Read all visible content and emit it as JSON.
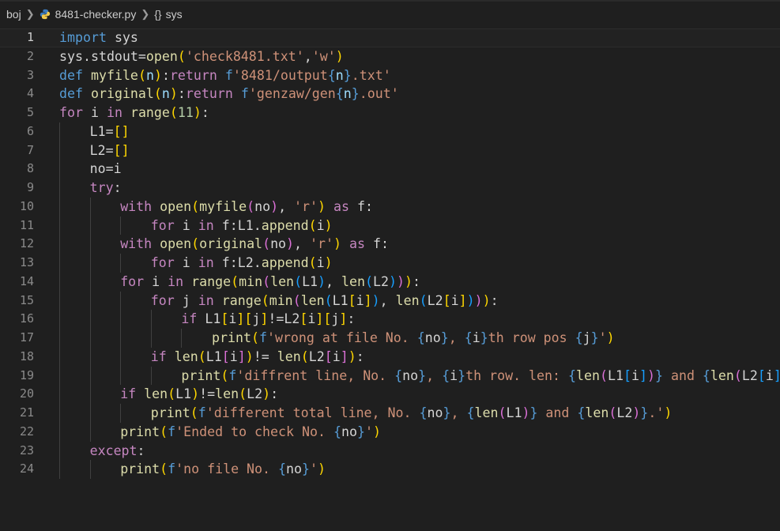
{
  "breadcrumb": {
    "folder": "boj",
    "file": "8481-checker.py",
    "symbol": "sys"
  },
  "editor": {
    "lines": [
      {
        "num": "1",
        "indent": 0,
        "tokens": [
          [
            "k",
            "import"
          ],
          [
            "w",
            " sys"
          ]
        ]
      },
      {
        "num": "2",
        "indent": 0,
        "tokens": [
          [
            "w",
            "sys.stdout="
          ],
          [
            "f",
            "open"
          ],
          [
            "b1",
            "("
          ],
          [
            "s",
            "'check8481.txt'"
          ],
          [
            "w",
            ","
          ],
          [
            "s",
            "'w'"
          ],
          [
            "b1",
            ")"
          ]
        ]
      },
      {
        "num": "3",
        "indent": 0,
        "tokens": [
          [
            "k",
            "def"
          ],
          [
            "w",
            " "
          ],
          [
            "f",
            "myfile"
          ],
          [
            "b1",
            "("
          ],
          [
            "v",
            "n"
          ],
          [
            "b1",
            ")"
          ],
          [
            "w",
            ":"
          ],
          [
            "c",
            "return"
          ],
          [
            "w",
            " "
          ],
          [
            "k",
            "f"
          ],
          [
            "s",
            "'8481/output"
          ],
          [
            "k",
            "{"
          ],
          [
            "v",
            "n"
          ],
          [
            "k",
            "}"
          ],
          [
            "s",
            ".txt'"
          ]
        ]
      },
      {
        "num": "4",
        "indent": 0,
        "tokens": [
          [
            "k",
            "def"
          ],
          [
            "w",
            " "
          ],
          [
            "f",
            "original"
          ],
          [
            "b1",
            "("
          ],
          [
            "v",
            "n"
          ],
          [
            "b1",
            ")"
          ],
          [
            "w",
            ":"
          ],
          [
            "c",
            "return"
          ],
          [
            "w",
            " "
          ],
          [
            "k",
            "f"
          ],
          [
            "s",
            "'genzaw/gen"
          ],
          [
            "k",
            "{"
          ],
          [
            "v",
            "n"
          ],
          [
            "k",
            "}"
          ],
          [
            "s",
            ".out'"
          ]
        ]
      },
      {
        "num": "5",
        "indent": 0,
        "tokens": [
          [
            "c",
            "for"
          ],
          [
            "w",
            " i "
          ],
          [
            "c",
            "in"
          ],
          [
            "w",
            " "
          ],
          [
            "f",
            "range"
          ],
          [
            "b1",
            "("
          ],
          [
            "n",
            "11"
          ],
          [
            "b1",
            ")"
          ],
          [
            "w",
            ":"
          ]
        ]
      },
      {
        "num": "6",
        "indent": 1,
        "tokens": [
          [
            "w",
            "L1="
          ],
          [
            "b1",
            "[]"
          ]
        ]
      },
      {
        "num": "7",
        "indent": 1,
        "tokens": [
          [
            "w",
            "L2="
          ],
          [
            "b1",
            "[]"
          ]
        ]
      },
      {
        "num": "8",
        "indent": 1,
        "tokens": [
          [
            "w",
            "no=i"
          ]
        ]
      },
      {
        "num": "9",
        "indent": 1,
        "tokens": [
          [
            "c",
            "try"
          ],
          [
            "w",
            ":"
          ]
        ]
      },
      {
        "num": "10",
        "indent": 2,
        "tokens": [
          [
            "c",
            "with"
          ],
          [
            "w",
            " "
          ],
          [
            "f",
            "open"
          ],
          [
            "b1",
            "("
          ],
          [
            "f",
            "myfile"
          ],
          [
            "b2",
            "("
          ],
          [
            "w",
            "no"
          ],
          [
            "b2",
            ")"
          ],
          [
            "w",
            ", "
          ],
          [
            "s",
            "'r'"
          ],
          [
            "b1",
            ")"
          ],
          [
            "w",
            " "
          ],
          [
            "c",
            "as"
          ],
          [
            "w",
            " f:"
          ]
        ]
      },
      {
        "num": "11",
        "indent": 3,
        "tokens": [
          [
            "c",
            "for"
          ],
          [
            "w",
            " i "
          ],
          [
            "c",
            "in"
          ],
          [
            "w",
            " f:L1."
          ],
          [
            "f",
            "append"
          ],
          [
            "b1",
            "("
          ],
          [
            "w",
            "i"
          ],
          [
            "b1",
            ")"
          ]
        ]
      },
      {
        "num": "12",
        "indent": 2,
        "tokens": [
          [
            "c",
            "with"
          ],
          [
            "w",
            " "
          ],
          [
            "f",
            "open"
          ],
          [
            "b1",
            "("
          ],
          [
            "f",
            "original"
          ],
          [
            "b2",
            "("
          ],
          [
            "w",
            "no"
          ],
          [
            "b2",
            ")"
          ],
          [
            "w",
            ", "
          ],
          [
            "s",
            "'r'"
          ],
          [
            "b1",
            ")"
          ],
          [
            "w",
            " "
          ],
          [
            "c",
            "as"
          ],
          [
            "w",
            " f:"
          ]
        ]
      },
      {
        "num": "13",
        "indent": 3,
        "tokens": [
          [
            "c",
            "for"
          ],
          [
            "w",
            " i "
          ],
          [
            "c",
            "in"
          ],
          [
            "w",
            " f:L2."
          ],
          [
            "f",
            "append"
          ],
          [
            "b1",
            "("
          ],
          [
            "w",
            "i"
          ],
          [
            "b1",
            ")"
          ]
        ]
      },
      {
        "num": "14",
        "indent": 2,
        "tokens": [
          [
            "c",
            "for"
          ],
          [
            "w",
            " i "
          ],
          [
            "c",
            "in"
          ],
          [
            "w",
            " "
          ],
          [
            "f",
            "range"
          ],
          [
            "b1",
            "("
          ],
          [
            "f",
            "min"
          ],
          [
            "b2",
            "("
          ],
          [
            "f",
            "len"
          ],
          [
            "b3",
            "("
          ],
          [
            "w",
            "L1"
          ],
          [
            "b3",
            ")"
          ],
          [
            "w",
            ", "
          ],
          [
            "f",
            "len"
          ],
          [
            "b3",
            "("
          ],
          [
            "w",
            "L2"
          ],
          [
            "b3",
            ")"
          ],
          [
            "b2",
            ")"
          ],
          [
            "b1",
            ")"
          ],
          [
            "w",
            ":"
          ]
        ]
      },
      {
        "num": "15",
        "indent": 3,
        "tokens": [
          [
            "c",
            "for"
          ],
          [
            "w",
            " j "
          ],
          [
            "c",
            "in"
          ],
          [
            "w",
            " "
          ],
          [
            "f",
            "range"
          ],
          [
            "b1",
            "("
          ],
          [
            "f",
            "min"
          ],
          [
            "b2",
            "("
          ],
          [
            "f",
            "len"
          ],
          [
            "b3",
            "("
          ],
          [
            "w",
            "L1"
          ],
          [
            "b1",
            "["
          ],
          [
            "w",
            "i"
          ],
          [
            "b1",
            "]"
          ],
          [
            "b3",
            ")"
          ],
          [
            "w",
            ", "
          ],
          [
            "f",
            "len"
          ],
          [
            "b3",
            "("
          ],
          [
            "w",
            "L2"
          ],
          [
            "b1",
            "["
          ],
          [
            "w",
            "i"
          ],
          [
            "b1",
            "]"
          ],
          [
            "b3",
            ")"
          ],
          [
            "b2",
            ")"
          ],
          [
            "b1",
            ")"
          ],
          [
            "w",
            ":"
          ]
        ]
      },
      {
        "num": "16",
        "indent": 4,
        "tokens": [
          [
            "c",
            "if"
          ],
          [
            "w",
            " L1"
          ],
          [
            "b1",
            "["
          ],
          [
            "w",
            "i"
          ],
          [
            "b1",
            "]"
          ],
          [
            "b1",
            "["
          ],
          [
            "w",
            "j"
          ],
          [
            "b1",
            "]"
          ],
          [
            "w",
            "!=L2"
          ],
          [
            "b1",
            "["
          ],
          [
            "w",
            "i"
          ],
          [
            "b1",
            "]"
          ],
          [
            "b1",
            "["
          ],
          [
            "w",
            "j"
          ],
          [
            "b1",
            "]"
          ],
          [
            "w",
            ":"
          ]
        ]
      },
      {
        "num": "17",
        "indent": 5,
        "tokens": [
          [
            "f",
            "print"
          ],
          [
            "b1",
            "("
          ],
          [
            "k",
            "f"
          ],
          [
            "s",
            "'wrong at file No. "
          ],
          [
            "k",
            "{"
          ],
          [
            "w",
            "no"
          ],
          [
            "k",
            "}"
          ],
          [
            "s",
            ", "
          ],
          [
            "k",
            "{"
          ],
          [
            "w",
            "i"
          ],
          [
            "k",
            "}"
          ],
          [
            "s",
            "th row pos "
          ],
          [
            "k",
            "{"
          ],
          [
            "w",
            "j"
          ],
          [
            "k",
            "}"
          ],
          [
            "s",
            "'"
          ],
          [
            "b1",
            ")"
          ]
        ]
      },
      {
        "num": "18",
        "indent": 3,
        "tokens": [
          [
            "c",
            "if"
          ],
          [
            "w",
            " "
          ],
          [
            "f",
            "len"
          ],
          [
            "b1",
            "("
          ],
          [
            "w",
            "L1"
          ],
          [
            "b2",
            "["
          ],
          [
            "w",
            "i"
          ],
          [
            "b2",
            "]"
          ],
          [
            "b1",
            ")"
          ],
          [
            "w",
            "!= "
          ],
          [
            "f",
            "len"
          ],
          [
            "b1",
            "("
          ],
          [
            "w",
            "L2"
          ],
          [
            "b2",
            "["
          ],
          [
            "w",
            "i"
          ],
          [
            "b2",
            "]"
          ],
          [
            "b1",
            ")"
          ],
          [
            "w",
            ":"
          ]
        ]
      },
      {
        "num": "19",
        "indent": 4,
        "tokens": [
          [
            "f",
            "print"
          ],
          [
            "b1",
            "("
          ],
          [
            "k",
            "f"
          ],
          [
            "s",
            "'diffrent line, No. "
          ],
          [
            "k",
            "{"
          ],
          [
            "w",
            "no"
          ],
          [
            "k",
            "}"
          ],
          [
            "s",
            ", "
          ],
          [
            "k",
            "{"
          ],
          [
            "w",
            "i"
          ],
          [
            "k",
            "}"
          ],
          [
            "s",
            "th row. len: "
          ],
          [
            "k",
            "{"
          ],
          [
            "f",
            "len"
          ],
          [
            "b2",
            "("
          ],
          [
            "w",
            "L1"
          ],
          [
            "b3",
            "["
          ],
          [
            "w",
            "i"
          ],
          [
            "b3",
            "]"
          ],
          [
            "b2",
            ")"
          ],
          [
            "k",
            "}"
          ],
          [
            "s",
            " and "
          ],
          [
            "k",
            "{"
          ],
          [
            "f",
            "len"
          ],
          [
            "b2",
            "("
          ],
          [
            "w",
            "L2"
          ],
          [
            "b3",
            "["
          ],
          [
            "w",
            "i"
          ],
          [
            "b3",
            "]"
          ],
          [
            "b2",
            ")"
          ],
          [
            "k",
            "}"
          ],
          [
            "s",
            "'"
          ]
        ]
      },
      {
        "num": "20",
        "indent": 2,
        "tokens": [
          [
            "c",
            "if"
          ],
          [
            "w",
            " "
          ],
          [
            "f",
            "len"
          ],
          [
            "b1",
            "("
          ],
          [
            "w",
            "L1"
          ],
          [
            "b1",
            ")"
          ],
          [
            "w",
            "!="
          ],
          [
            "f",
            "len"
          ],
          [
            "b1",
            "("
          ],
          [
            "w",
            "L2"
          ],
          [
            "b1",
            ")"
          ],
          [
            "w",
            ":"
          ]
        ]
      },
      {
        "num": "21",
        "indent": 3,
        "tokens": [
          [
            "f",
            "print"
          ],
          [
            "b1",
            "("
          ],
          [
            "k",
            "f"
          ],
          [
            "s",
            "'different total line, No. "
          ],
          [
            "k",
            "{"
          ],
          [
            "w",
            "no"
          ],
          [
            "k",
            "}"
          ],
          [
            "s",
            ", "
          ],
          [
            "k",
            "{"
          ],
          [
            "f",
            "len"
          ],
          [
            "b2",
            "("
          ],
          [
            "w",
            "L1"
          ],
          [
            "b2",
            ")"
          ],
          [
            "k",
            "}"
          ],
          [
            "s",
            " and "
          ],
          [
            "k",
            "{"
          ],
          [
            "f",
            "len"
          ],
          [
            "b2",
            "("
          ],
          [
            "w",
            "L2"
          ],
          [
            "b2",
            ")"
          ],
          [
            "k",
            "}"
          ],
          [
            "s",
            ".'"
          ],
          [
            "b1",
            ")"
          ]
        ]
      },
      {
        "num": "22",
        "indent": 2,
        "tokens": [
          [
            "f",
            "print"
          ],
          [
            "b1",
            "("
          ],
          [
            "k",
            "f"
          ],
          [
            "s",
            "'Ended to check No. "
          ],
          [
            "k",
            "{"
          ],
          [
            "w",
            "no"
          ],
          [
            "k",
            "}"
          ],
          [
            "s",
            "'"
          ],
          [
            "b1",
            ")"
          ]
        ]
      },
      {
        "num": "23",
        "indent": 1,
        "tokens": [
          [
            "c",
            "except"
          ],
          [
            "w",
            ":"
          ]
        ]
      },
      {
        "num": "24",
        "indent": 2,
        "tokens": [
          [
            "f",
            "print"
          ],
          [
            "b1",
            "("
          ],
          [
            "k",
            "f"
          ],
          [
            "s",
            "'no file No. "
          ],
          [
            "k",
            "{"
          ],
          [
            "w",
            "no"
          ],
          [
            "k",
            "}"
          ],
          [
            "s",
            "'"
          ],
          [
            "b1",
            ")"
          ]
        ]
      }
    ]
  }
}
